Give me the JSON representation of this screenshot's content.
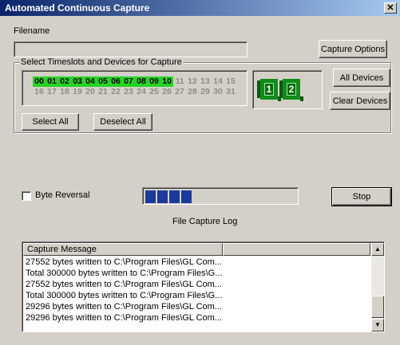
{
  "window": {
    "title": "Automated Continuous Capture",
    "close_glyph": "✕"
  },
  "filename": {
    "label": "Filename",
    "value": ""
  },
  "buttons": {
    "capture_options": "Capture Options",
    "all_devices": "All Devices",
    "clear_devices": "Clear Devices",
    "select_all": "Select All",
    "deselect_all": "Deselect All",
    "stop": "Stop"
  },
  "group": {
    "title": "Select Timeslots and Devices for Capture"
  },
  "timeslots": {
    "row1": [
      {
        "label": "00",
        "selected": true
      },
      {
        "label": "01",
        "selected": true
      },
      {
        "label": "02",
        "selected": true
      },
      {
        "label": "03",
        "selected": true
      },
      {
        "label": "04",
        "selected": true
      },
      {
        "label": "05",
        "selected": true
      },
      {
        "label": "06",
        "selected": true
      },
      {
        "label": "07",
        "selected": true
      },
      {
        "label": "08",
        "selected": true
      },
      {
        "label": "09",
        "selected": true
      },
      {
        "label": "10",
        "selected": true
      },
      {
        "label": "11",
        "selected": false
      },
      {
        "label": "12",
        "selected": false
      },
      {
        "label": "13",
        "selected": false
      },
      {
        "label": "14",
        "selected": false
      },
      {
        "label": "15",
        "selected": false
      }
    ],
    "row2": [
      {
        "label": "16",
        "selected": false
      },
      {
        "label": "17",
        "selected": false
      },
      {
        "label": "18",
        "selected": false
      },
      {
        "label": "19",
        "selected": false
      },
      {
        "label": "20",
        "selected": false
      },
      {
        "label": "21",
        "selected": false
      },
      {
        "label": "22",
        "selected": false
      },
      {
        "label": "23",
        "selected": false
      },
      {
        "label": "24",
        "selected": false
      },
      {
        "label": "25",
        "selected": false
      },
      {
        "label": "26",
        "selected": false
      },
      {
        "label": "27",
        "selected": false
      },
      {
        "label": "28",
        "selected": false
      },
      {
        "label": "29",
        "selected": false
      },
      {
        "label": "30",
        "selected": false
      },
      {
        "label": "31",
        "selected": false
      }
    ]
  },
  "devices": [
    {
      "label": "1"
    },
    {
      "label": "2"
    }
  ],
  "byte_reversal": {
    "label": "Byte Reversal",
    "checked": false
  },
  "progress": {
    "filled_blocks": 4
  },
  "log": {
    "title": "File Capture Log",
    "column_header": "Capture Message",
    "rows": [
      "27552 bytes written to C:\\Program Files\\GL Com...",
      "Total 300000 bytes written to C:\\Program Files\\G...",
      "27552 bytes written to C:\\Program Files\\GL Com...",
      "Total 300000 bytes written to C:\\Program Files\\G...",
      "29296 bytes written to C:\\Program Files\\GL Com...",
      "29296 bytes written to C:\\Program Files\\GL Com..."
    ]
  },
  "colors": {
    "titlebar_start": "#0a246a",
    "titlebar_end": "#a6caf0",
    "timeslot_selected": "#24d424",
    "progress_fill": "#1a3a9c",
    "device_card": "#108c18"
  }
}
